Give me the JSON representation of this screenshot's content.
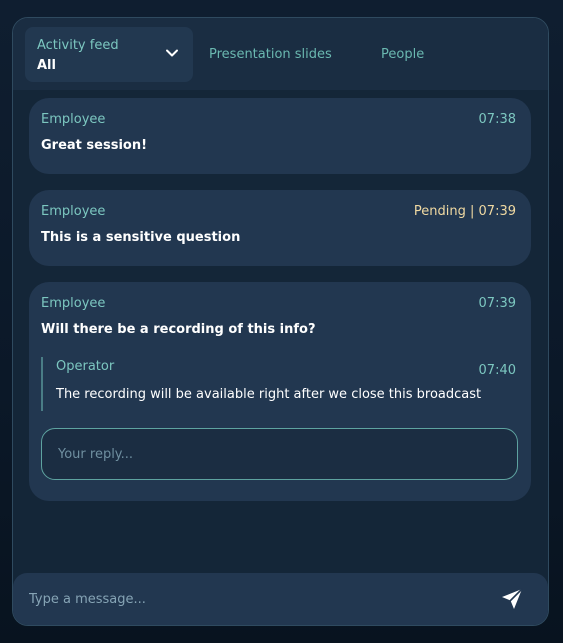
{
  "tabs": {
    "activity_feed": {
      "title": "Activity feed",
      "selected": "All",
      "icon": "chevron-down-icon"
    },
    "presentation_slides": "Presentation slides",
    "people": "People"
  },
  "messages": [
    {
      "author": "Employee",
      "time": "07:38",
      "text": "Great session!"
    },
    {
      "author": "Employee",
      "time": "Pending | 07:39",
      "status": "pending",
      "text": "This is a sensitive question"
    },
    {
      "author": "Employee",
      "time": "07:39",
      "text": "Will there be a recording of this info?",
      "reply": {
        "author": "Operator",
        "time": "07:40",
        "text": "The recording will be available right after we close this broadcast"
      },
      "reply_placeholder": "Your reply..."
    }
  ],
  "composer": {
    "placeholder": "Type a message...",
    "send_icon": "send-icon"
  },
  "colors": {
    "accent": "#7cc7c0",
    "pending": "#f0d9a2",
    "card": "#223750"
  }
}
